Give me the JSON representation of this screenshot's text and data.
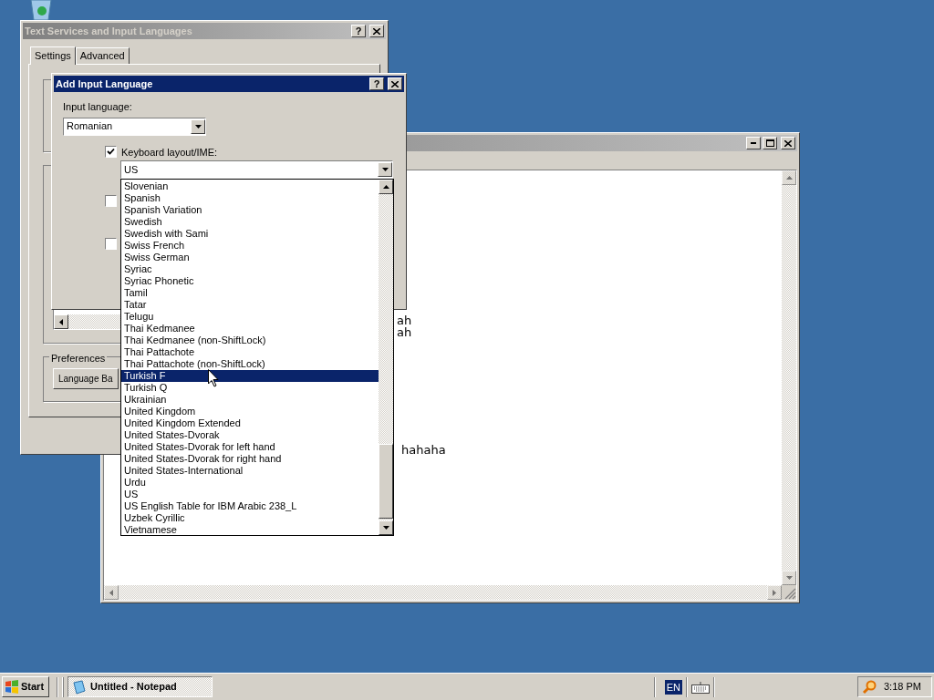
{
  "notepad": {
    "active": false,
    "lines": [
      "ah",
      "ah",
      "hahaha"
    ]
  },
  "text_services": {
    "title": "Text Services and Input Languages",
    "active": false,
    "help": "?",
    "tabs": [
      {
        "label": "Settings",
        "selected": true
      },
      {
        "label": "Advanced",
        "selected": false
      }
    ],
    "preferences_label": "Preferences",
    "language_bar_button": "Language Ba"
  },
  "add_language": {
    "title": "Add Input Language",
    "active": true,
    "help": "?",
    "input_language_label": "Input language:",
    "input_language": "Romanian",
    "keyboard": {
      "label": "Keyboard layout/IME:",
      "checked": true
    },
    "layout_value": "US",
    "other_options": [
      {
        "checked": false
      },
      {
        "checked": false
      }
    ],
    "layouts": [
      {
        "label": "Slovenian",
        "selected": false
      },
      {
        "label": "Spanish",
        "selected": false
      },
      {
        "label": "Spanish Variation",
        "selected": false
      },
      {
        "label": "Swedish",
        "selected": false
      },
      {
        "label": "Swedish with Sami",
        "selected": false
      },
      {
        "label": "Swiss French",
        "selected": false
      },
      {
        "label": "Swiss German",
        "selected": false
      },
      {
        "label": "Syriac",
        "selected": false
      },
      {
        "label": "Syriac Phonetic",
        "selected": false
      },
      {
        "label": "Tamil",
        "selected": false
      },
      {
        "label": "Tatar",
        "selected": false
      },
      {
        "label": "Telugu",
        "selected": false
      },
      {
        "label": "Thai Kedmanee",
        "selected": false
      },
      {
        "label": "Thai Kedmanee (non-ShiftLock)",
        "selected": false
      },
      {
        "label": "Thai Pattachote",
        "selected": false
      },
      {
        "label": "Thai Pattachote (non-ShiftLock)",
        "selected": false
      },
      {
        "label": "Turkish F",
        "selected": true
      },
      {
        "label": "Turkish Q",
        "selected": false
      },
      {
        "label": "Ukrainian",
        "selected": false
      },
      {
        "label": "United Kingdom",
        "selected": false
      },
      {
        "label": "United Kingdom Extended",
        "selected": false
      },
      {
        "label": "United States-Dvorak",
        "selected": false
      },
      {
        "label": "United States-Dvorak for left hand",
        "selected": false
      },
      {
        "label": "United States-Dvorak for right hand",
        "selected": false
      },
      {
        "label": "United States-International",
        "selected": false
      },
      {
        "label": "Urdu",
        "selected": false
      },
      {
        "label": "US",
        "selected": false
      },
      {
        "label": "US English Table for IBM Arabic 238_L",
        "selected": false
      },
      {
        "label": "Uzbek Cyrillic",
        "selected": false
      },
      {
        "label": "Vietnamese",
        "selected": false
      }
    ]
  },
  "taskbar": {
    "start": "Start",
    "tasks": [
      {
        "label": "Untitled - Notepad",
        "selected": true
      }
    ],
    "language": "EN",
    "clock": "3:18 PM"
  }
}
